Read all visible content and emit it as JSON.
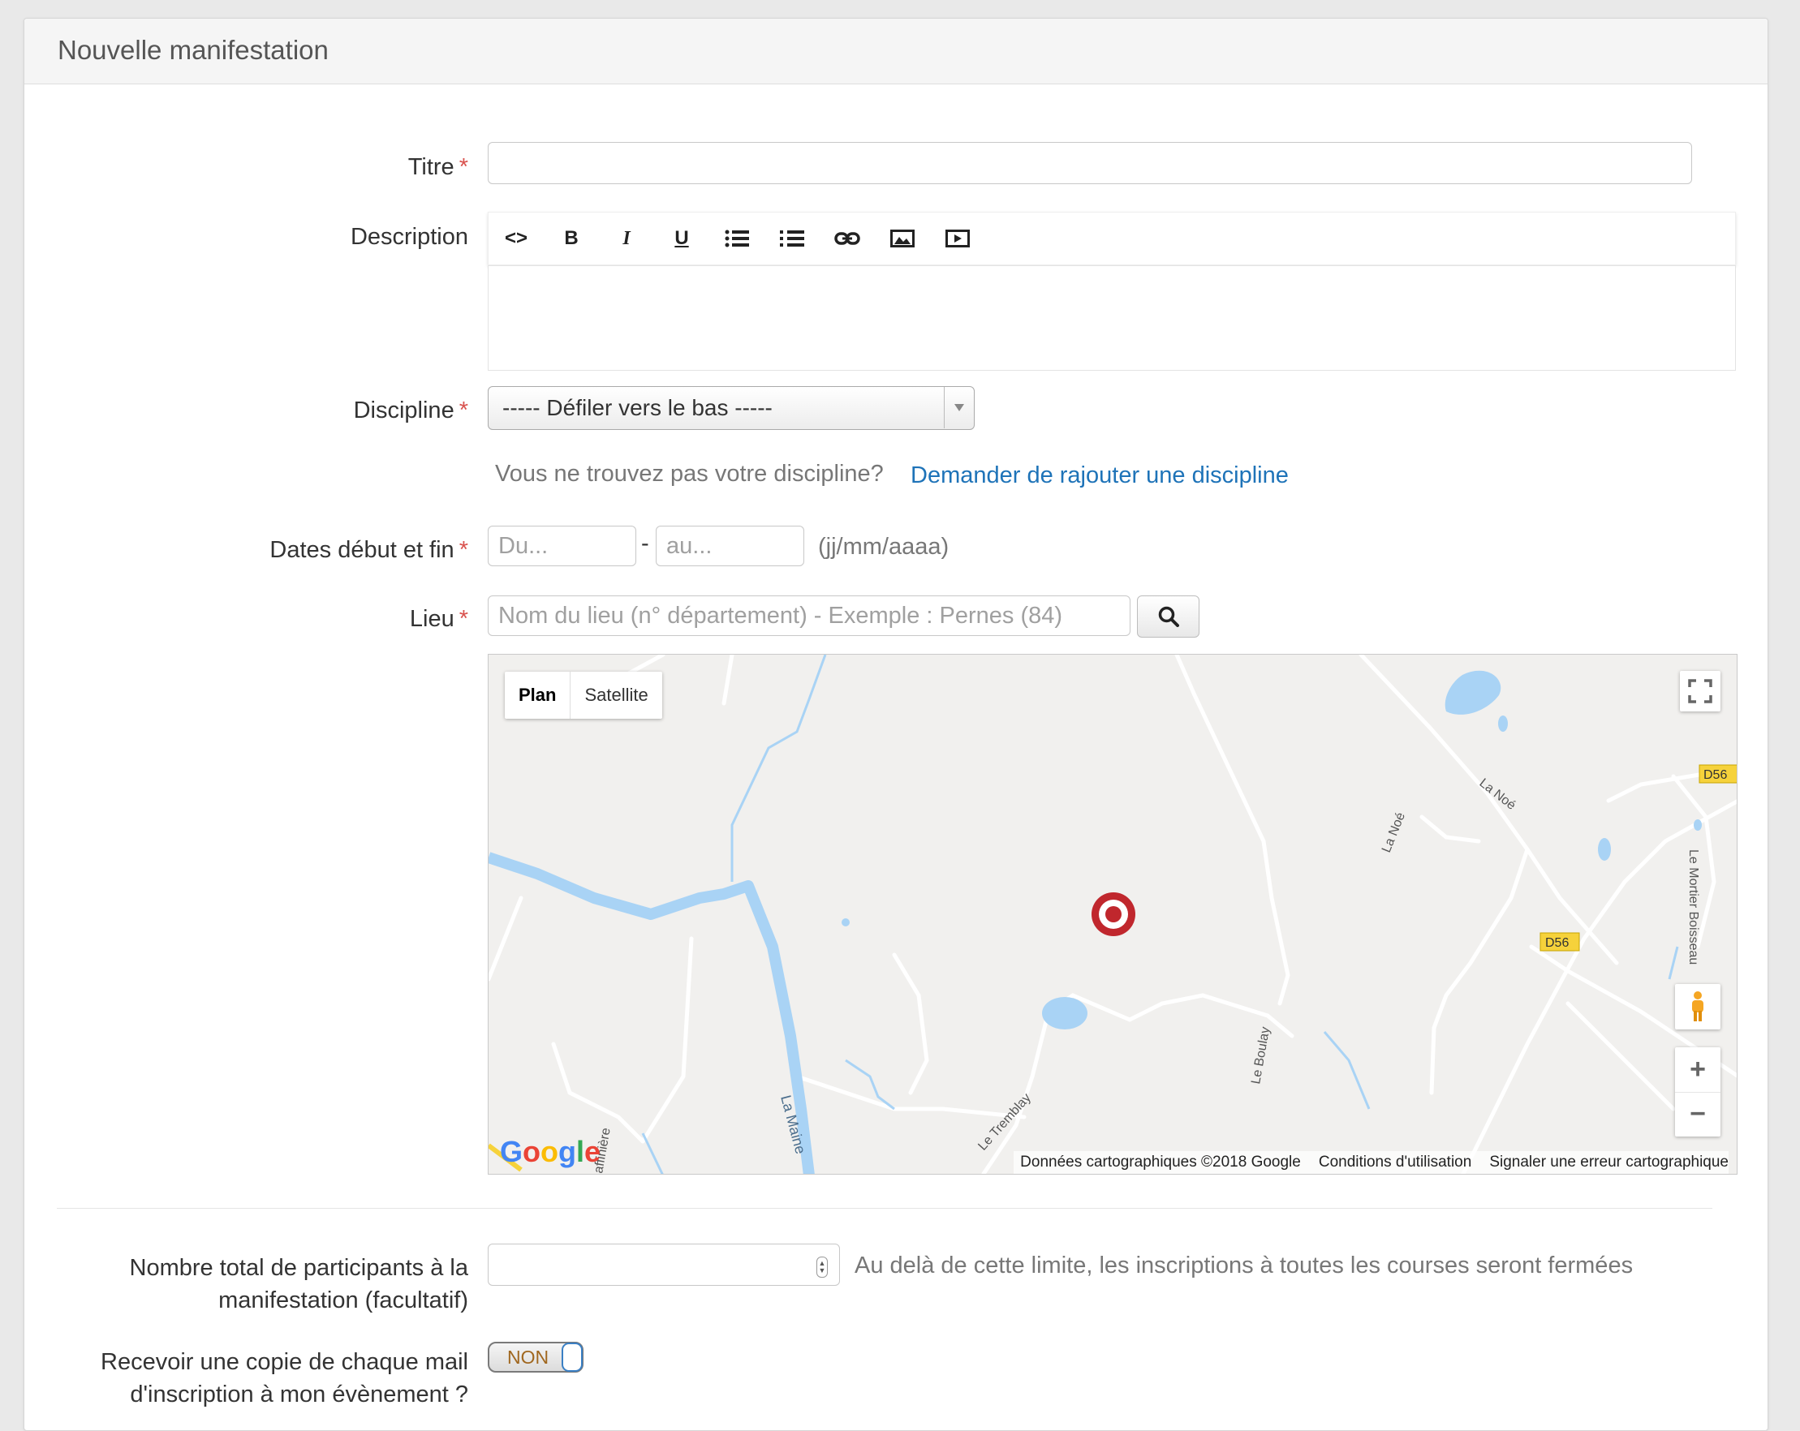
{
  "panel": {
    "title": "Nouvelle manifestation"
  },
  "form": {
    "required_mark": "*",
    "titre": {
      "label": "Titre",
      "value": ""
    },
    "description": {
      "label": "Description",
      "toolbar": [
        "code-icon",
        "bold-icon",
        "italic-icon",
        "underline-icon",
        "bullet-list-icon",
        "numbered-list-icon",
        "link-icon",
        "image-icon",
        "video-icon"
      ],
      "bold": "B",
      "italic": "I",
      "underline": "U",
      "code": "<>"
    },
    "discipline": {
      "label": "Discipline",
      "selected": "----- Défiler vers le bas -----",
      "help_text": "Vous ne trouvez pas votre discipline?",
      "help_link": "Demander de rajouter une discipline"
    },
    "dates": {
      "label": "Dates début et fin",
      "start_placeholder": "Du...",
      "separator": "-",
      "end_placeholder": "au...",
      "format_hint": "(jj/mm/aaaa)"
    },
    "lieu": {
      "label": "Lieu",
      "placeholder": "Nom du lieu (n° département) - Exemple : Pernes (84)"
    },
    "participants": {
      "label_line1": "Nombre total de participants à la",
      "label_line2": "manifestation (facultatif)",
      "hint": "Au delà de cette limite, les inscriptions à toutes les courses seront fermées",
      "value": ""
    },
    "copie_mail": {
      "label_line1": "Recevoir une copie de chaque mail",
      "label_line2": "d'inscription à mon évènement ?",
      "toggle": "NON"
    }
  },
  "map": {
    "type_plan": "Plan",
    "type_satellite": "Satellite",
    "attribution": "Données cartographiques ©2018 Google",
    "terms": "Conditions d'utilisation",
    "report": "Signaler une erreur cartographique",
    "logo": "Google",
    "zoom_in": "+",
    "zoom_out": "−",
    "labels": {
      "river": "La Maine",
      "road1": "La Noé",
      "road2": "La Noé",
      "road3": "Le Boulay",
      "road4": "Le Tremblay",
      "road5": "Le Mortier Boisseau",
      "road6": "affinière",
      "d56a": "D56",
      "d56b": "D56"
    },
    "colors": {
      "water": "#a9d3f5",
      "land": "#f1f0ee",
      "road": "#ffffff",
      "marker": "#c0272d"
    }
  }
}
